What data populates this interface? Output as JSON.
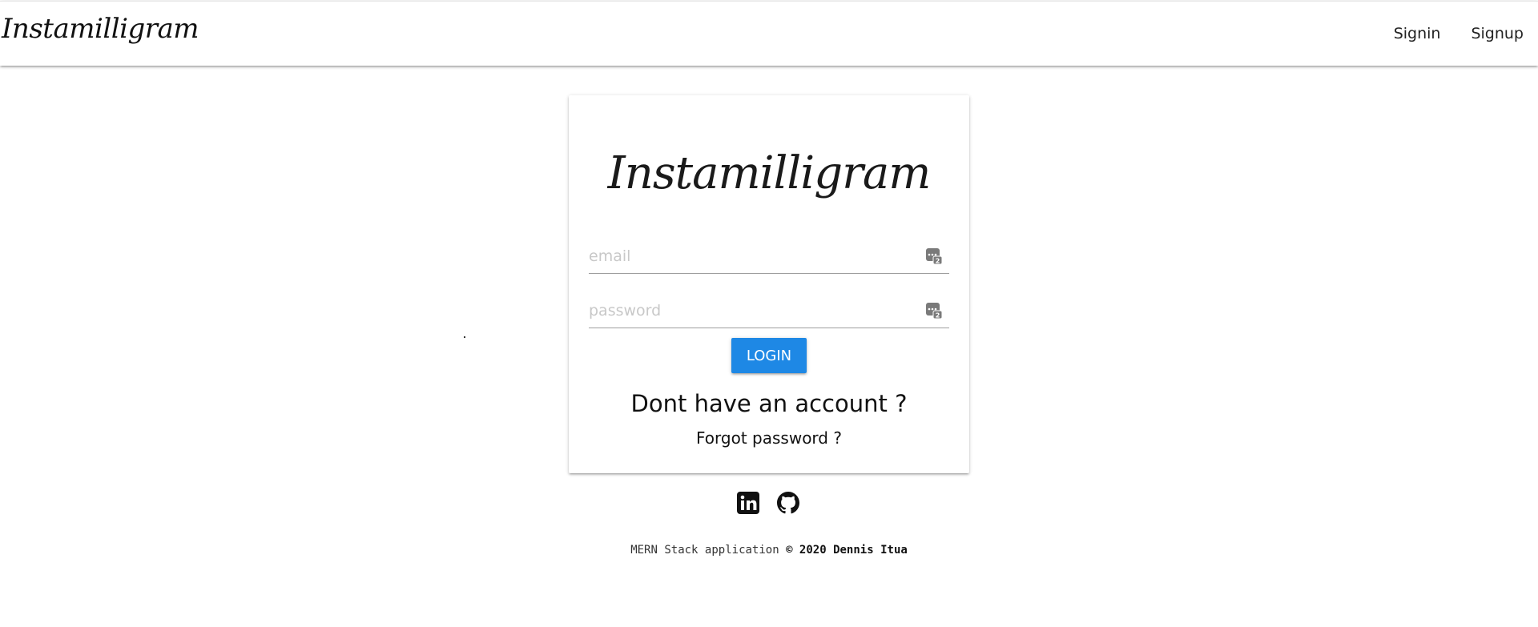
{
  "navbar": {
    "brand": "Instamilligram",
    "links": [
      {
        "label": "Signin"
      },
      {
        "label": "Signup"
      }
    ]
  },
  "login_card": {
    "logo": "Instamilligram",
    "email_placeholder": "email",
    "password_placeholder": "password",
    "login_label": "LOGIN",
    "signup_prompt": "Dont have an account ?",
    "forgot_prompt": "Forgot password ?",
    "field_icon": "password-manager-icon"
  },
  "social": {
    "linkedin_icon": "linkedin-icon",
    "github_icon": "github-icon"
  },
  "footer": {
    "prefix": "MERN Stack application",
    "suffix": "© 2020 Dennis Itua"
  },
  "colors": {
    "accent": "#1e88e5",
    "text": "#111111",
    "placeholder": "#c8c8c8"
  }
}
